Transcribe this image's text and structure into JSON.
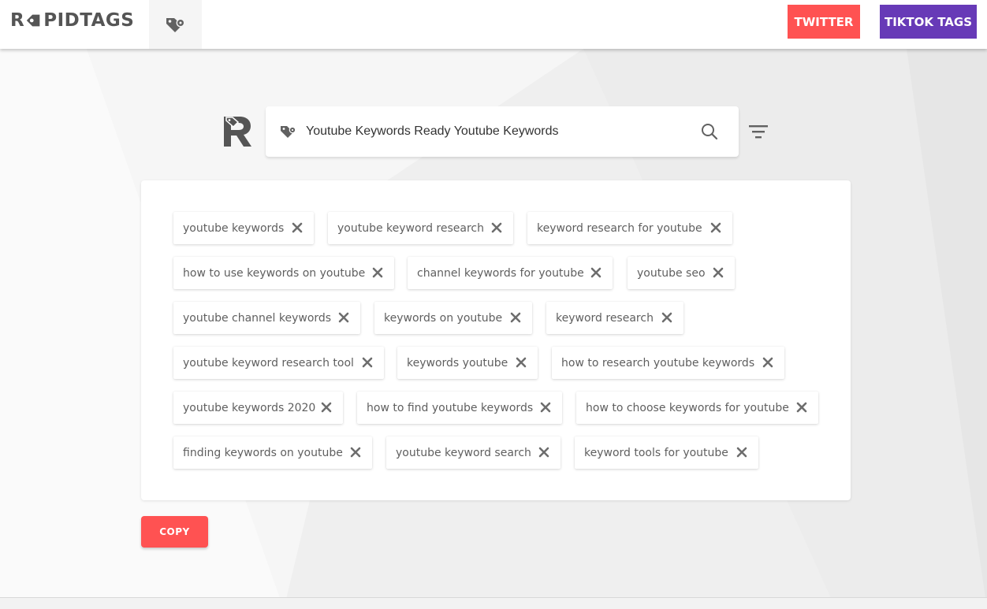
{
  "header": {
    "logo_left": "R",
    "logo_right": "PIDTAGS",
    "twitter_label": "TWITTER",
    "tiktok_label": "TIKTOK TAGS"
  },
  "search": {
    "value": "Youtube Keywords Ready Youtube Keywords"
  },
  "tags": [
    "youtube keywords",
    "youtube keyword research",
    "keyword research for youtube",
    "how to use keywords on youtube",
    "channel keywords for youtube",
    "youtube seo",
    "youtube channel keywords",
    "keywords on youtube",
    "keyword research",
    "youtube keyword research tool",
    "keywords youtube",
    "how to research youtube keywords",
    "youtube keywords 2020",
    "how to find youtube keywords",
    "how to choose keywords for youtube",
    "finding keywords on youtube",
    "youtube keyword search",
    "keyword tools for youtube"
  ],
  "copy_label": "COPY",
  "colors": {
    "accent_red": "#ff5252",
    "accent_purple": "#673ab7",
    "icon_gray": "#616161"
  },
  "icons": [
    "tag-gear-icon",
    "search-icon",
    "filter-icon",
    "close-icon"
  ]
}
